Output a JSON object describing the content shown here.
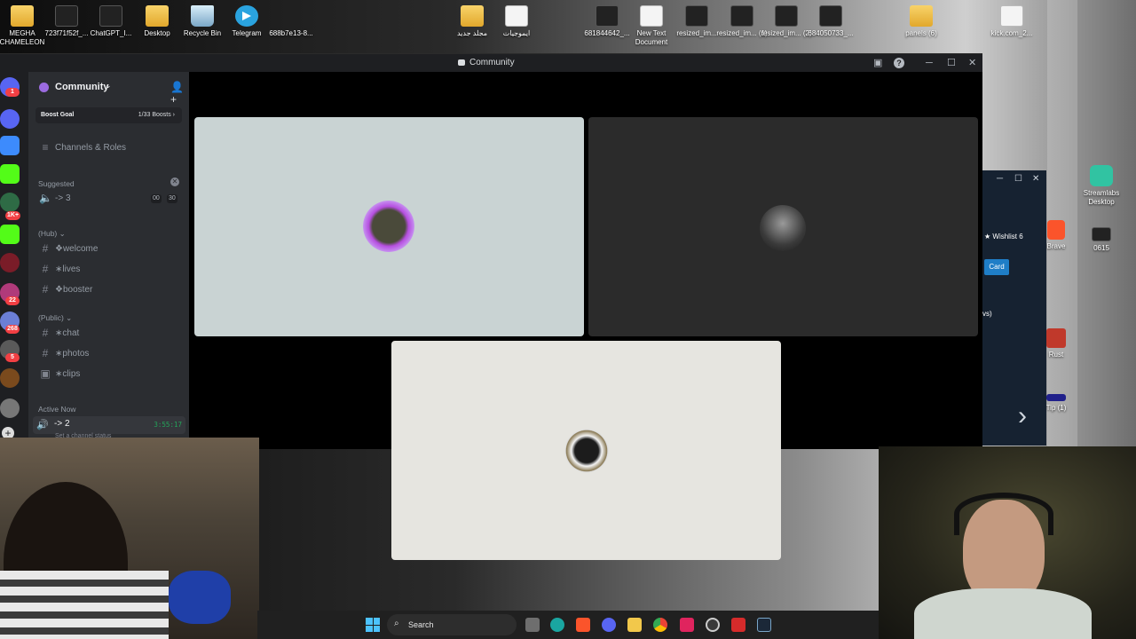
{
  "desktop": {
    "icons": [
      {
        "label": "MEGHA CHAMELEON",
        "type": "folder"
      },
      {
        "label": "723f71f52f_...",
        "type": "image"
      },
      {
        "label": "ChatGPT_I...",
        "type": "image"
      },
      {
        "label": "Desktop",
        "type": "folder"
      },
      {
        "label": "Recycle Bin",
        "type": "bin"
      },
      {
        "label": "Telegram",
        "type": "telegram"
      },
      {
        "label": "688b7e13-8...",
        "type": "image"
      },
      {
        "label": "مجلد جديد",
        "type": "folder"
      },
      {
        "label": "ايموجيات",
        "type": "document"
      },
      {
        "label": "681844642_...",
        "type": "image"
      },
      {
        "label": "New Text Document",
        "type": "document"
      },
      {
        "label": "resized_im...",
        "type": "image"
      },
      {
        "label": "resized_im... (1)",
        "type": "image"
      },
      {
        "label": "resized_im... (2)",
        "type": "image"
      },
      {
        "label": "684050733_...",
        "type": "image"
      },
      {
        "label": "panels (6)",
        "type": "folder"
      },
      {
        "label": "kick.com_2...",
        "type": "document"
      }
    ],
    "right_icons": [
      {
        "label": "Streamlabs Desktop"
      },
      {
        "label": "Brave"
      },
      {
        "label": "0615"
      },
      {
        "label": "Rust"
      },
      {
        "label": "Tip (1)"
      }
    ]
  },
  "window": {
    "title": "Community"
  },
  "server": {
    "name": "Community",
    "boost_label": "Boost Goal",
    "boost_count": "1/33 Boosts",
    "channels_roles": "Channels & Roles"
  },
  "guild_badges": [
    "1",
    "1K+",
    "22",
    "268",
    "5"
  ],
  "sections": {
    "suggested": "Suggested",
    "hub": "(Hub)",
    "public": "(Public)",
    "active_now": "Active Now"
  },
  "suggested_channel": {
    "name": "-> 3",
    "count_a": "00",
    "count_b": "30"
  },
  "hub_channels": [
    "❖welcome",
    "∗lives",
    "❖booster"
  ],
  "public_channels": [
    "∗chat",
    "∗photos",
    "∗clips"
  ],
  "active_channel": {
    "name": "-> 2",
    "timer": "3:55:17",
    "status_hint": "Set a channel status"
  },
  "background_window": {
    "wishlist": "Wishlist",
    "wishlist_count": "6",
    "card": "Card",
    "partial_text": "vs)"
  },
  "taskbar": {
    "search_label": "Search"
  },
  "colors": {
    "discord_bg": "#2b2d31",
    "guild_bg": "#1e1f22",
    "tile_1": "#c9d3d3",
    "tile_2": "#2b2b2b",
    "tile_3": "#e6e5e0",
    "accent_green": "#23a55a",
    "badge_red": "#f23f43"
  }
}
